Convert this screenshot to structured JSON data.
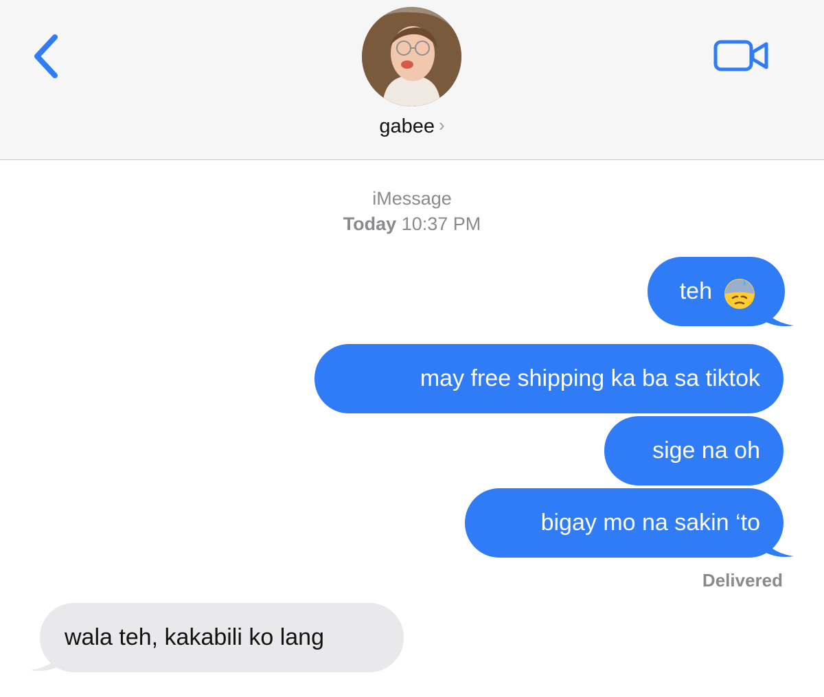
{
  "header": {
    "contact_name": "gabee",
    "chevron": "›",
    "back_icon": "chevron-left-icon",
    "video_icon": "video-camera-icon"
  },
  "thread": {
    "service": "iMessage",
    "day": "Today",
    "time": "10:37 PM",
    "status": "Delivered"
  },
  "messages": [
    {
      "direction": "outgoing",
      "text": "teh",
      "emoji": "downcast-sweat-face"
    },
    {
      "direction": "outgoing",
      "text": "may free shipping ka ba sa tiktok"
    },
    {
      "direction": "outgoing",
      "text": "sige na oh"
    },
    {
      "direction": "outgoing",
      "text": "bigay mo na sakin ‘to"
    },
    {
      "direction": "incoming",
      "text": "wala teh, kakabili ko lang"
    }
  ],
  "colors": {
    "outgoing_bubble": "#2f7cf6",
    "incoming_bubble": "#e9e9eb",
    "accent": "#2f7cf6"
  }
}
